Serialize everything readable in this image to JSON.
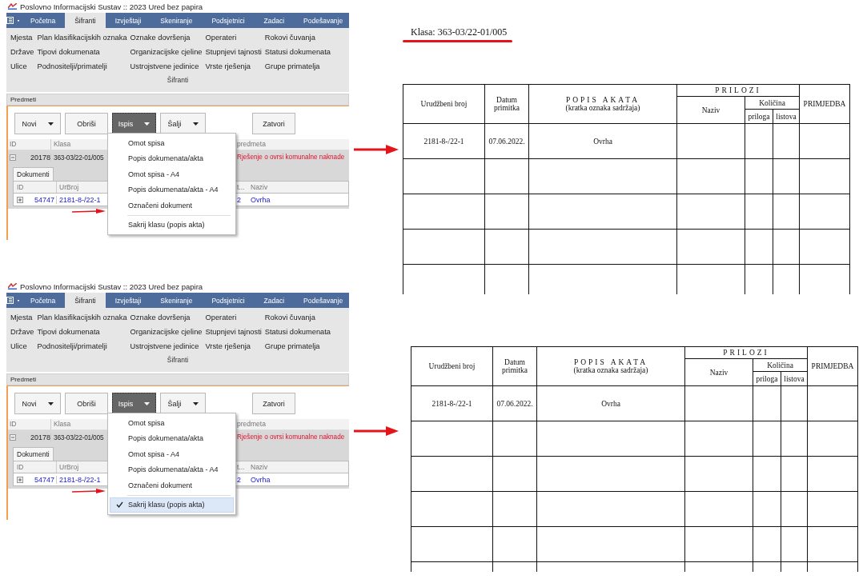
{
  "panels": [
    {
      "app": {
        "title": "Poslovno Informacijski Sustav :: 2023 Ured bez papira",
        "tabs": [
          {
            "label": "Početna",
            "selected": false
          },
          {
            "label": "Šifranti",
            "selected": true
          },
          {
            "label": "Izvještaji",
            "selected": false
          },
          {
            "label": "Skeniranje",
            "selected": false
          },
          {
            "label": "Podsjetnici",
            "selected": false
          },
          {
            "label": "Zadaci",
            "selected": false
          },
          {
            "label": "Podešavanje",
            "selected": false
          }
        ],
        "ribbon_columns": [
          [
            "Mjesta",
            "Države",
            "Ulice"
          ],
          [
            "Plan klasifikacijskih oznaka",
            "Tipovi dokumenata",
            "Podnositelji/primatelji"
          ],
          [
            "Oznake dovršenja",
            "Organizacijske cjeline",
            "Ustrojstvene jedinice"
          ],
          [
            "Operateri",
            "Stupnjevi tajnosti",
            "Vrste rješenja"
          ],
          [
            "Rokovi čuvanja",
            "Statusi dokumenata",
            "Grupe primatelja"
          ]
        ],
        "ribbon_group": "Šifranti",
        "section": "Predmeti",
        "buttons": [
          {
            "label": "Novi",
            "dropdown": true,
            "pressed": false
          },
          {
            "label": "Obriši",
            "dropdown": false,
            "pressed": false
          },
          {
            "label": "Ispis",
            "dropdown": true,
            "pressed": true
          },
          {
            "label": "Šalji",
            "dropdown": true,
            "pressed": false
          },
          {
            "label": "Zatvori",
            "dropdown": false,
            "pressed": false
          }
        ],
        "grid": {
          "columns": [
            "ID",
            "Klasa",
            "predmeta"
          ],
          "row": [
            "20178",
            "363-03/22-01/005",
            "Rješenje o ovrsi komunalne naknade"
          ]
        },
        "detail": {
          "tab": "Dokumenti",
          "columns": [
            "ID",
            "UrBroj",
            "t...",
            "Naziv"
          ],
          "row": [
            "54747",
            "2181-8-/22-1",
            "2",
            "Ovrha"
          ]
        },
        "menu": [
          {
            "label": "Omot spisa",
            "checked": false,
            "selected": false
          },
          {
            "label": "Popis dokumenata/akta",
            "checked": false,
            "selected": false
          },
          {
            "label": "Omot spisa - A4",
            "checked": false,
            "selected": false
          },
          {
            "label": "Popis dokumenata/akta - A4",
            "checked": false,
            "selected": false
          },
          {
            "label": "Označeni dokument",
            "checked": false,
            "selected": false
          },
          {
            "label": "Sakrij klasu (popis akta)",
            "checked": false,
            "selected": false
          }
        ]
      },
      "document": {
        "klasa": "Klasa: 363-03/22-01/005",
        "headers": {
          "urudzbeni_broj": "Urudžbeni broj",
          "datum": "Datum primitka",
          "popis_akata": "POPIS AKATA",
          "popis_note": "(kratka oznaka sadržaja)",
          "prilozi": "PRILOZI",
          "naziv": "Naziv",
          "kolicina": "Količina",
          "priloga": "priloga",
          "listova": "listova",
          "primjedba": "PRIMJEDBA"
        },
        "rows": [
          [
            "2181-8-/22-1",
            "07.06.2022.",
            "Ovrha"
          ]
        ]
      }
    },
    {
      "app": {
        "title": "Poslovno Informacijski Sustav :: 2023 Ured bez papira",
        "tabs": [
          {
            "label": "Početna",
            "selected": false
          },
          {
            "label": "Šifranti",
            "selected": true
          },
          {
            "label": "Izvještaji",
            "selected": false
          },
          {
            "label": "Skeniranje",
            "selected": false
          },
          {
            "label": "Podsjetnici",
            "selected": false
          },
          {
            "label": "Zadaci",
            "selected": false
          },
          {
            "label": "Podešavanje",
            "selected": false
          }
        ],
        "ribbon_columns": [
          [
            "Mjesta",
            "Države",
            "Ulice"
          ],
          [
            "Plan klasifikacijskih oznaka",
            "Tipovi dokumenata",
            "Podnositelji/primatelji"
          ],
          [
            "Oznake dovršenja",
            "Organizacijske cjeline",
            "Ustrojstvene jedinice"
          ],
          [
            "Operateri",
            "Stupnjevi tajnosti",
            "Vrste rješenja"
          ],
          [
            "Rokovi čuvanja",
            "Statusi dokumenata",
            "Grupe primatelja"
          ]
        ],
        "ribbon_group": "Šifranti",
        "section": "Predmeti",
        "buttons": [
          {
            "label": "Novi",
            "dropdown": true,
            "pressed": false
          },
          {
            "label": "Obriši",
            "dropdown": false,
            "pressed": false
          },
          {
            "label": "Ispis",
            "dropdown": true,
            "pressed": true
          },
          {
            "label": "Šalji",
            "dropdown": true,
            "pressed": false
          },
          {
            "label": "Zatvori",
            "dropdown": false,
            "pressed": false
          }
        ],
        "grid": {
          "columns": [
            "ID",
            "Klasa",
            "predmeta"
          ],
          "row": [
            "20178",
            "363-03/22-01/005",
            "Rješenje o ovrsi komunalne naknade"
          ]
        },
        "detail": {
          "tab": "Dokumenti",
          "columns": [
            "ID",
            "UrBroj",
            "t...",
            "Naziv"
          ],
          "row": [
            "54747",
            "2181-8-/22-1",
            "2",
            "Ovrha"
          ]
        },
        "menu": [
          {
            "label": "Omot spisa",
            "checked": false,
            "selected": false
          },
          {
            "label": "Popis dokumenata/akta",
            "checked": false,
            "selected": false
          },
          {
            "label": "Omot spisa - A4",
            "checked": false,
            "selected": false
          },
          {
            "label": "Popis dokumenata/akta - A4",
            "checked": false,
            "selected": false
          },
          {
            "label": "Označeni dokument",
            "checked": false,
            "selected": false
          },
          {
            "label": "Sakrij klasu (popis akta)",
            "checked": true,
            "selected": true
          }
        ]
      },
      "document": {
        "headers": {
          "urudzbeni_broj": "Urudžbeni broj",
          "datum": "Datum primitka",
          "popis_akata": "POPIS AKATA",
          "popis_note": "(kratka oznaka sadržaja)",
          "prilozi": "PRILOZI",
          "naziv": "Naziv",
          "kolicina": "Količina",
          "priloga": "priloga",
          "listova": "listova",
          "primjedba": "PRIMJEDBA"
        },
        "rows": [
          [
            "2181-8-/22-1",
            "07.06.2022.",
            "Ovrha"
          ]
        ]
      }
    }
  ]
}
